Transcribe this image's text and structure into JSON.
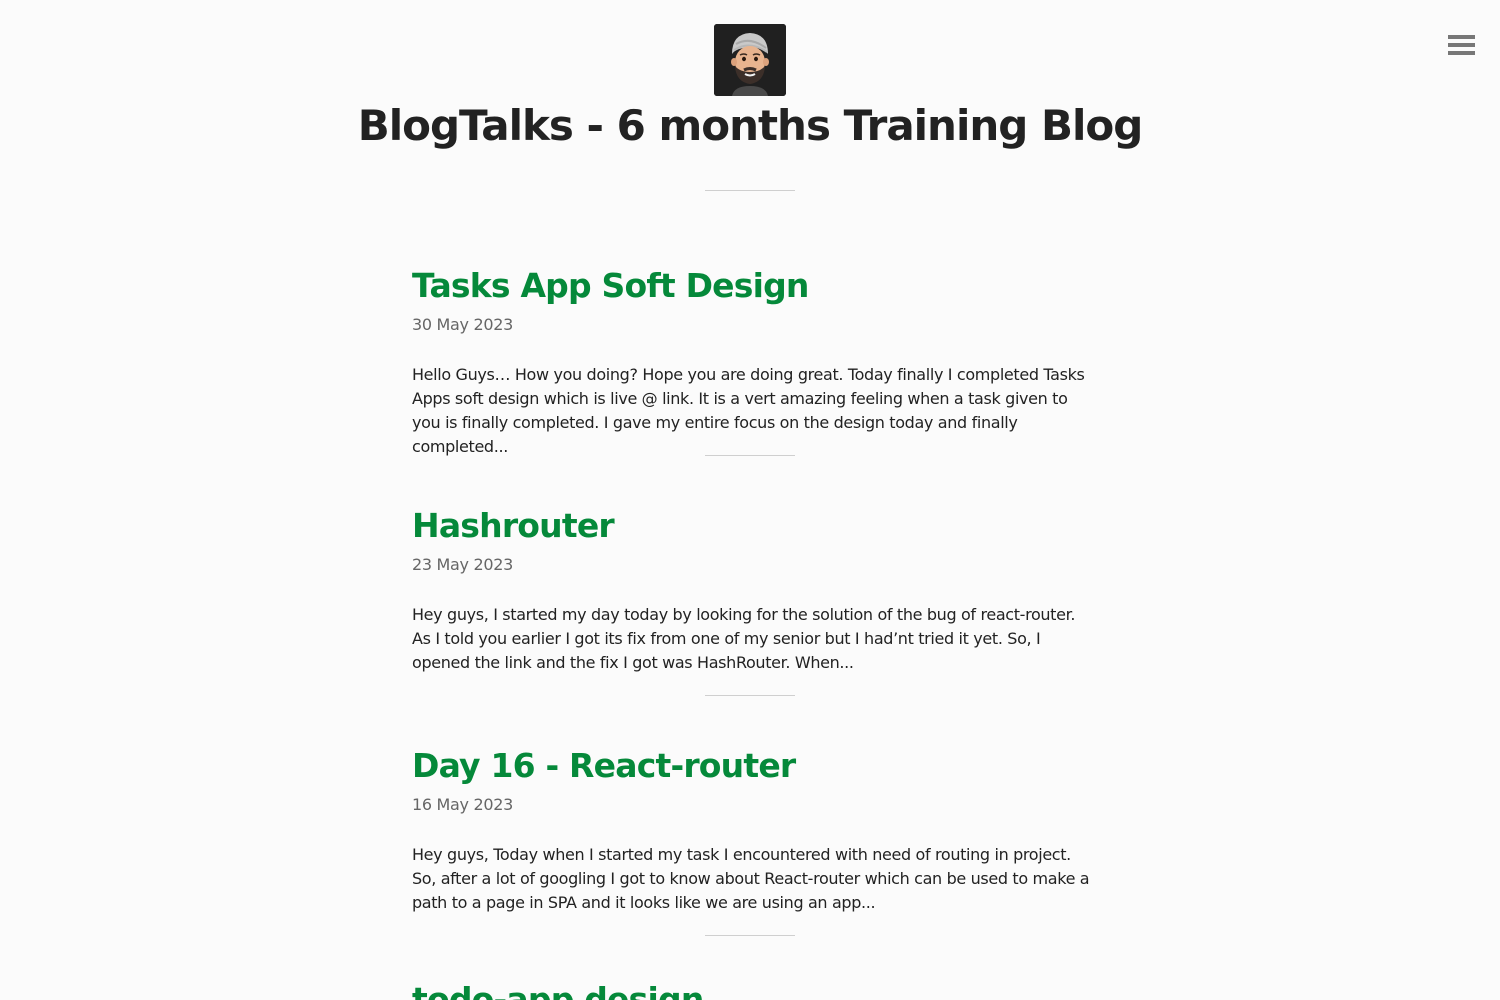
{
  "site": {
    "title": "BlogTalks - 6 months Training Blog",
    "avatar_icon": "memoji-avatar-icon",
    "menu_icon": "hamburger-menu-icon"
  },
  "colors": {
    "background": "#fbfbfb",
    "post_title": "#05893a",
    "text": "#222222",
    "date": "#666666",
    "divider": "#cfcfcf",
    "avatar_bg": "#202020"
  },
  "posts": [
    {
      "title": "Tasks App Soft Design",
      "date": "30 May 2023",
      "excerpt": "Hello Guys… How you doing? Hope you are doing great. Today finally I completed Tasks Apps soft design which is live @ link. It is a vert amazing feeling when a task given to you is finally completed. I gave my entire focus on the design today and finally completed..."
    },
    {
      "title": "Hashrouter",
      "date": "23 May 2023",
      "excerpt": "Hey guys, I started my day today by looking for the solution of the bug of react-router. As I told you earlier I got its fix from one of my senior but I had’nt tried it yet. So, I opened the link and the fix I got was HashRouter. When..."
    },
    {
      "title": "Day 16 - React-router",
      "date": "16 May 2023",
      "excerpt": "Hey guys, Today when I started my task I encountered with need of routing in project. So, after a lot of googling I got to know about React-router which can be used to make a path to a page in SPA and it looks like we are using an app..."
    },
    {
      "title": "todo-app design",
      "date": "",
      "excerpt": ""
    }
  ]
}
